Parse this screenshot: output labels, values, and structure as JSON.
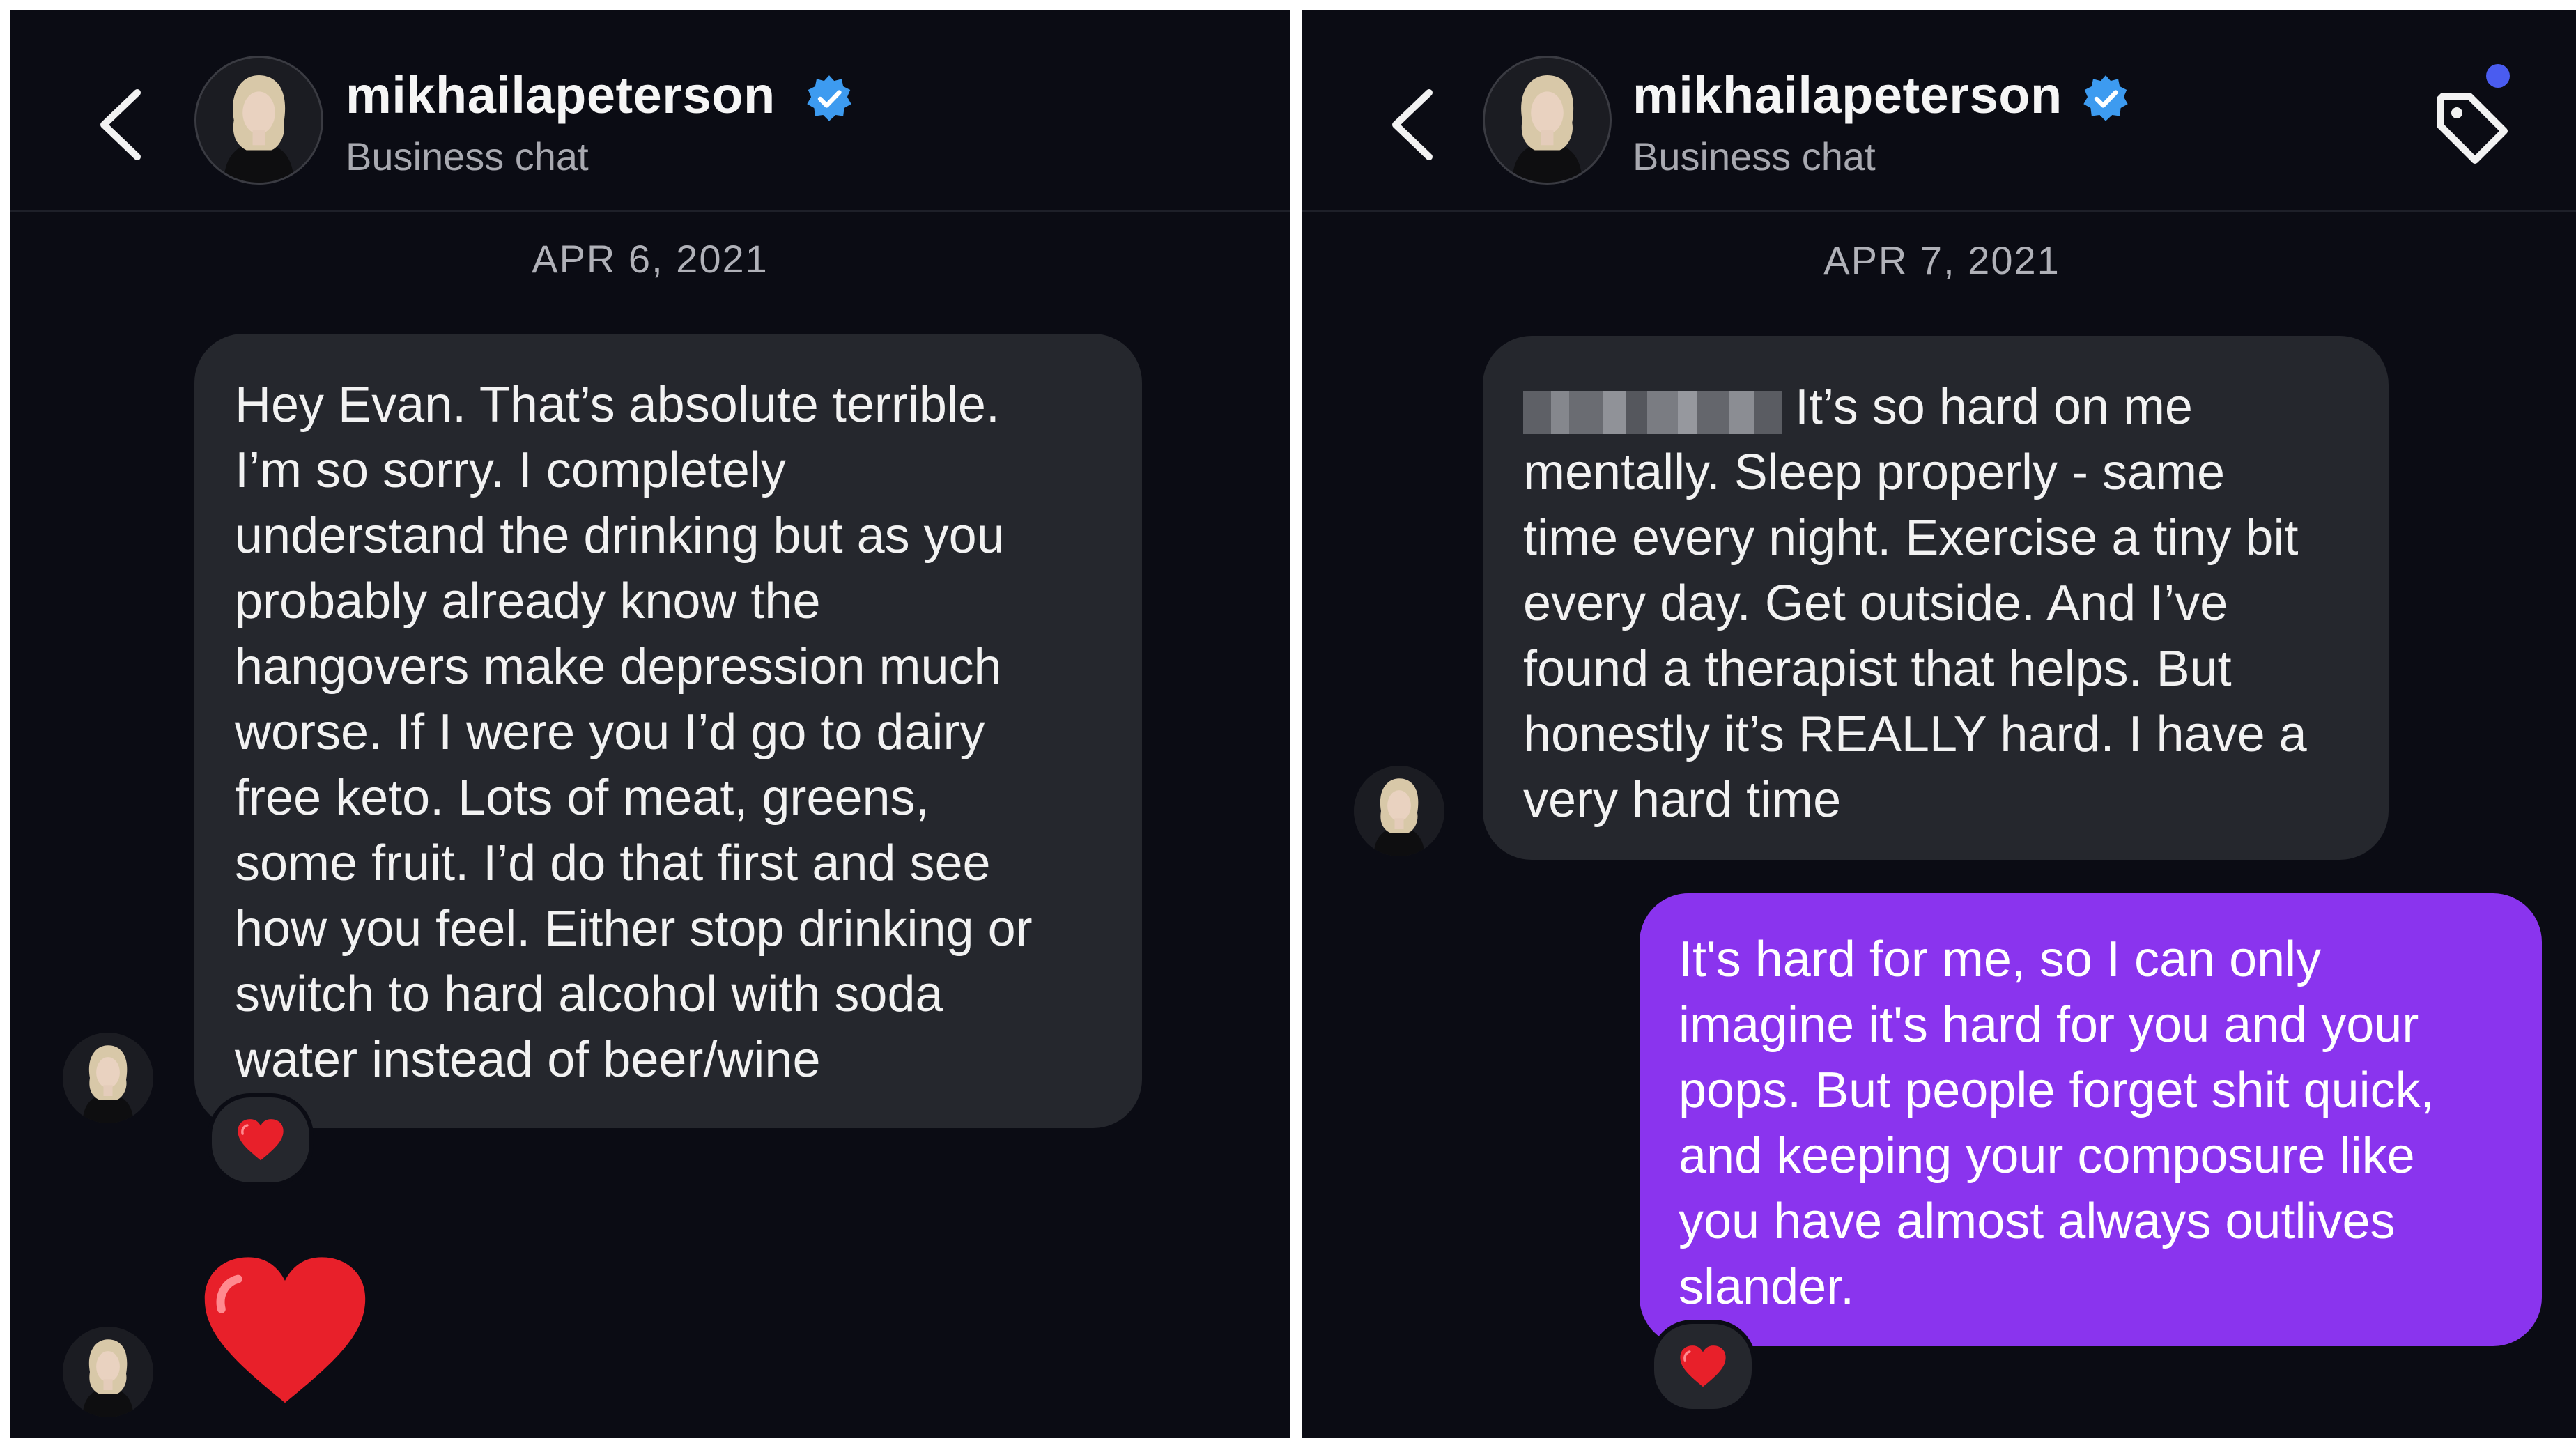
{
  "left": {
    "header": {
      "username": "mikhailapeterson",
      "subtitle": "Business chat"
    },
    "date": "APR 6, 2021",
    "message": {
      "lines": [
        "Hey Evan. That’s absolute terrible.",
        "I’m so sorry. I completely",
        "understand the drinking but as you",
        "probably already know the",
        "hangovers make depression much",
        "worse. If I were you I’d go to dairy",
        "free keto. Lots of meat, greens,",
        "some fruit. I’d do that first and see",
        "how you feel. Either stop drinking or",
        "switch to hard alcohol with soda",
        "water instead of beer/wine"
      ],
      "reaction": "heart-emoji"
    },
    "big_heart": "heart-emoji-large"
  },
  "right": {
    "header": {
      "username": "mikhailapeterson",
      "subtitle": "Business chat"
    },
    "date": "APR 7, 2021",
    "message_in": {
      "lines": [
        "It’s so hard on me",
        "mentally. Sleep properly - same",
        "time every night. Exercise a tiny bit",
        "every day. Get outside. And I’ve",
        "found a therapist that helps. But",
        "honestly it’s REALLY hard. I have a",
        "very hard time"
      ]
    },
    "message_out": {
      "lines": [
        "It's hard for me, so I can only",
        "imagine it's hard for you and your",
        "pops. But people forget shit quick,",
        "and keeping your composure like",
        "you have almost always outlives",
        "slander."
      ],
      "reaction": "heart-emoji"
    }
  },
  "colors": {
    "background": "#0b0c14",
    "incoming_bubble": "#25272d",
    "outgoing_bubble": "#8a34ee",
    "verified_badge": "#3d9bf0",
    "heart": "#e8202a"
  }
}
